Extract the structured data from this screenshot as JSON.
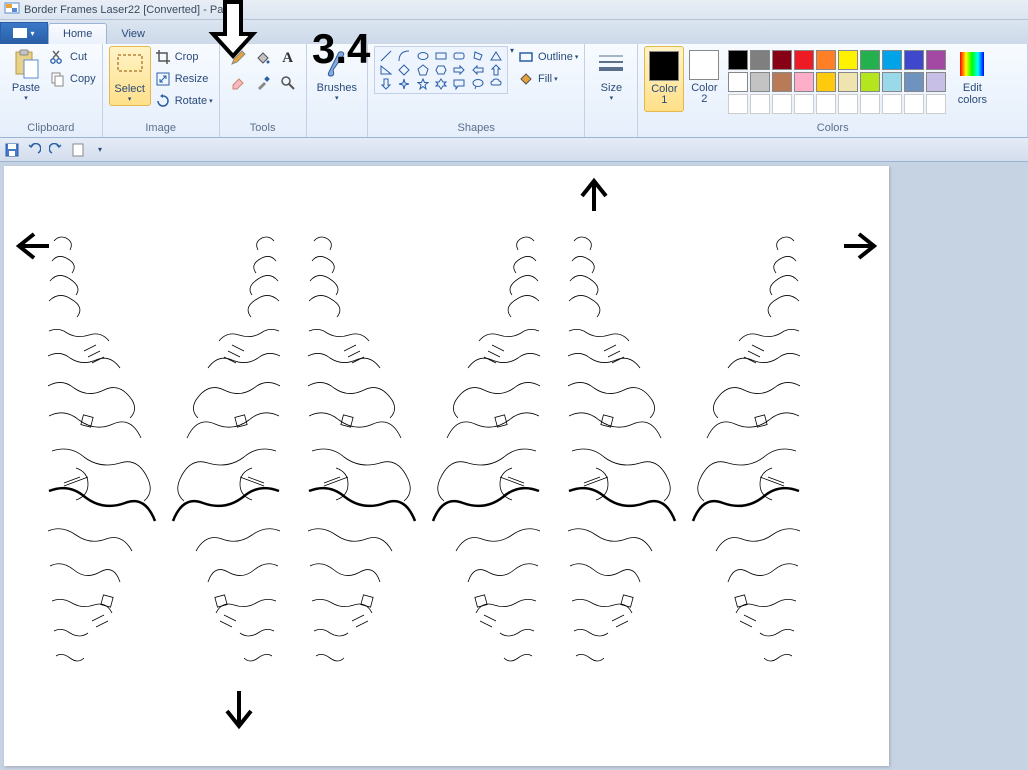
{
  "window": {
    "title": "Border Frames Laser22 [Converted] - Paint"
  },
  "tabs": {
    "home": "Home",
    "view": "View"
  },
  "ribbon": {
    "clipboard": {
      "label": "Clipboard",
      "paste": "Paste",
      "cut": "Cut",
      "copy": "Copy"
    },
    "image": {
      "label": "Image",
      "select": "Select",
      "crop": "Crop",
      "resize": "Resize",
      "rotate": "Rotate"
    },
    "tools": {
      "label": "Tools"
    },
    "brushes": {
      "label": "Brushes"
    },
    "shapes": {
      "label": "Shapes",
      "outline": "Outline",
      "fill": "Fill"
    },
    "size": {
      "label": "Size"
    },
    "colors": {
      "label": "Colors",
      "color1": "Color\n1",
      "color2": "Color\n2",
      "edit": "Edit\ncolors",
      "c1_value": "#000000",
      "c2_value": "#ffffff",
      "palette": [
        "#000000",
        "#7f7f7f",
        "#880015",
        "#ed1c24",
        "#ff7f27",
        "#fff200",
        "#22b14c",
        "#00a2e8",
        "#3f48cc",
        "#a349a4",
        "#ffffff",
        "#c3c3c3",
        "#b97a57",
        "#ffaec9",
        "#ffc90e",
        "#efe4b0",
        "#b5e61d",
        "#99d9ea",
        "#7092be",
        "#c8bfe7"
      ]
    }
  },
  "annotation": {
    "step": "3.4"
  }
}
